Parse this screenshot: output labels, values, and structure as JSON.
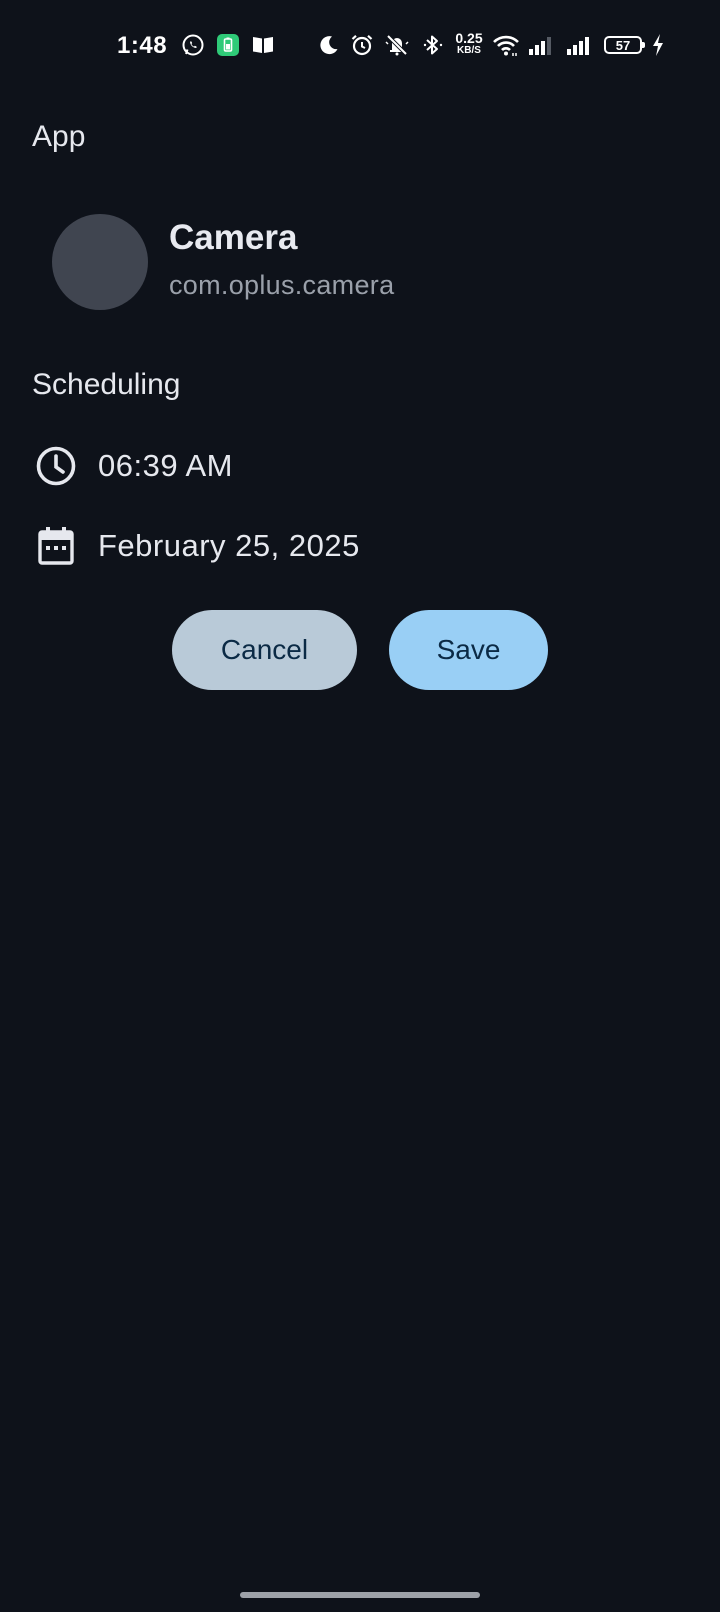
{
  "status_bar": {
    "time": "1:48",
    "net_speed_value": "0.25",
    "net_speed_unit": "KB/S",
    "battery": "57",
    "icons": [
      "whatsapp-icon",
      "battery-saver-icon",
      "book-icon",
      "moon-icon",
      "alarm-icon",
      "silent-icon",
      "bluetooth-icon",
      "wifi-icon",
      "signal-icon",
      "signal-icon",
      "charging-icon"
    ]
  },
  "app_section": {
    "title": "App",
    "app_name": "Camera",
    "package": "com.oplus.camera"
  },
  "scheduling_section": {
    "title": "Scheduling",
    "time": "06:39 AM",
    "date": "February 25, 2025"
  },
  "actions": {
    "cancel_label": "Cancel",
    "save_label": "Save"
  },
  "colors": {
    "background": "#0e121a",
    "cancel_button": "#b9cad8",
    "save_button": "#99cff5",
    "avatar": "#404550"
  }
}
